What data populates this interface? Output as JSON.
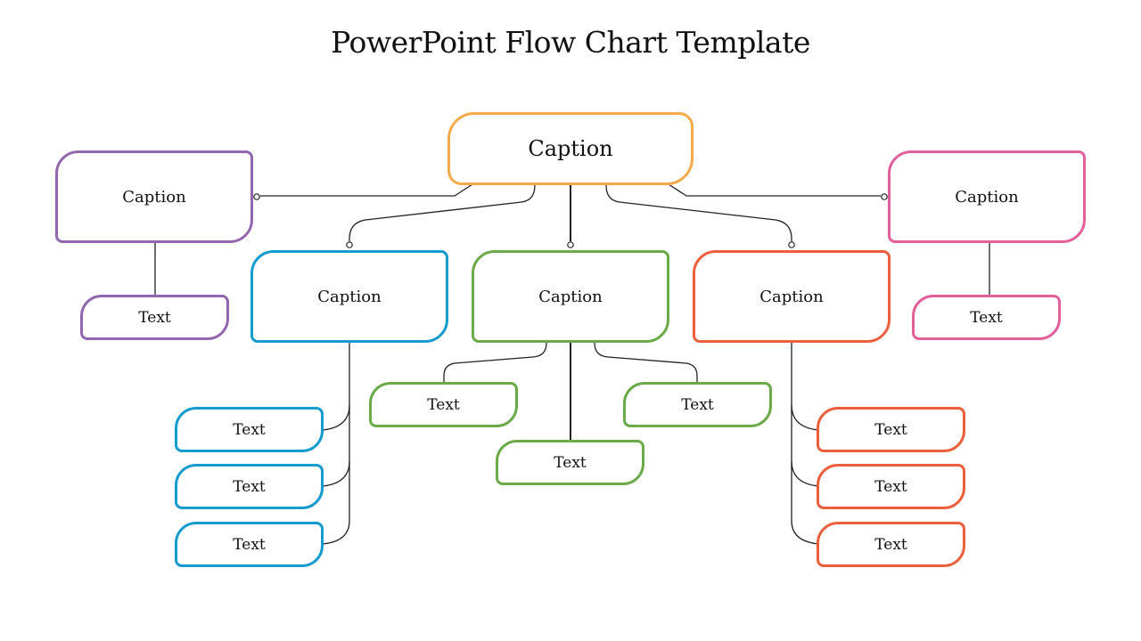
{
  "title": "PowerPoint Flow Chart Template",
  "colors": {
    "root": "#F5AA4A",
    "purple": "#9366AE",
    "blue": "#159BCD",
    "green": "#6AAA48",
    "orange": "#EC5F3C",
    "pink": "#E25F9A",
    "connector": "#222222"
  },
  "root": {
    "label": "Caption"
  },
  "branches": {
    "purple": {
      "caption": "Caption",
      "items": [
        "Text"
      ]
    },
    "blue": {
      "caption": "Caption",
      "items": [
        "Text",
        "Text",
        "Text"
      ]
    },
    "green": {
      "caption": "Caption",
      "items": [
        "Text",
        "Text",
        "Text"
      ]
    },
    "orange": {
      "caption": "Caption",
      "items": [
        "Text",
        "Text",
        "Text"
      ]
    },
    "pink": {
      "caption": "Caption",
      "items": [
        "Text"
      ]
    }
  }
}
